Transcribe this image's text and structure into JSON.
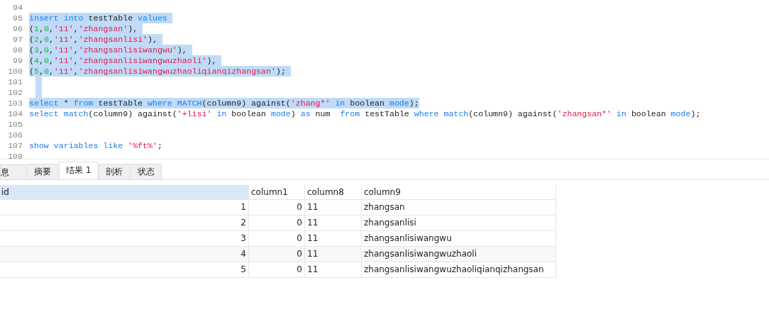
{
  "editor": {
    "lines": [
      {
        "number": "94",
        "selected": false
      },
      {
        "number": "95",
        "selected": true,
        "tokens": [
          {
            "text": "insert into ",
            "kind": "keyword"
          },
          {
            "text": "testTable ",
            "kind": "plain"
          },
          {
            "text": "values ",
            "kind": "keyword"
          }
        ]
      },
      {
        "number": "96",
        "selected": true,
        "tokens": [
          {
            "text": "(",
            "kind": "plain"
          },
          {
            "text": "1",
            "kind": "number"
          },
          {
            "text": ",",
            "kind": "plain"
          },
          {
            "text": "0",
            "kind": "number"
          },
          {
            "text": ",",
            "kind": "plain"
          },
          {
            "text": "'11'",
            "kind": "string"
          },
          {
            "text": ",",
            "kind": "plain"
          },
          {
            "text": "'zhangsan'",
            "kind": "string"
          },
          {
            "text": "), ",
            "kind": "plain"
          }
        ]
      },
      {
        "number": "97",
        "selected": true,
        "tokens": [
          {
            "text": "(",
            "kind": "plain"
          },
          {
            "text": "2",
            "kind": "number"
          },
          {
            "text": ",",
            "kind": "plain"
          },
          {
            "text": "0",
            "kind": "number"
          },
          {
            "text": ",",
            "kind": "plain"
          },
          {
            "text": "'11'",
            "kind": "string"
          },
          {
            "text": ",",
            "kind": "plain"
          },
          {
            "text": "'zhangsanlisi'",
            "kind": "string"
          },
          {
            "text": "), ",
            "kind": "plain"
          }
        ]
      },
      {
        "number": "98",
        "selected": true,
        "tokens": [
          {
            "text": "(",
            "kind": "plain"
          },
          {
            "text": "3",
            "kind": "number"
          },
          {
            "text": ",",
            "kind": "plain"
          },
          {
            "text": "0",
            "kind": "number"
          },
          {
            "text": ",",
            "kind": "plain"
          },
          {
            "text": "'11'",
            "kind": "string"
          },
          {
            "text": ",",
            "kind": "plain"
          },
          {
            "text": "'zhangsanlisiwangwu'",
            "kind": "string"
          },
          {
            "text": "), ",
            "kind": "plain"
          }
        ]
      },
      {
        "number": "99",
        "selected": true,
        "tokens": [
          {
            "text": "(",
            "kind": "plain"
          },
          {
            "text": "4",
            "kind": "number"
          },
          {
            "text": ",",
            "kind": "plain"
          },
          {
            "text": "0",
            "kind": "number"
          },
          {
            "text": ",",
            "kind": "plain"
          },
          {
            "text": "'11'",
            "kind": "string"
          },
          {
            "text": ",",
            "kind": "plain"
          },
          {
            "text": "'zhangsanlisiwangwuzhaoli'",
            "kind": "string"
          },
          {
            "text": "), ",
            "kind": "plain"
          }
        ]
      },
      {
        "number": "100",
        "selected": true,
        "tokens": [
          {
            "text": "(",
            "kind": "plain"
          },
          {
            "text": "5",
            "kind": "number"
          },
          {
            "text": ",",
            "kind": "plain"
          },
          {
            "text": "0",
            "kind": "number"
          },
          {
            "text": ",",
            "kind": "plain"
          },
          {
            "text": "'11'",
            "kind": "string"
          },
          {
            "text": ",",
            "kind": "plain"
          },
          {
            "text": "'zhangsanlisiwangwuzhaoliqianqizhangsan'",
            "kind": "string"
          },
          {
            "text": "); ",
            "kind": "plain"
          }
        ]
      },
      {
        "number": "101",
        "selected": true
      },
      {
        "number": "102",
        "selected": true
      },
      {
        "number": "103",
        "selected": true,
        "tokens": [
          {
            "text": "select ",
            "kind": "keyword"
          },
          {
            "text": "* ",
            "kind": "plain"
          },
          {
            "text": "from ",
            "kind": "keyword"
          },
          {
            "text": "testTable ",
            "kind": "plain"
          },
          {
            "text": "where MATCH",
            "kind": "keyword"
          },
          {
            "text": "(column9) against(",
            "kind": "plain"
          },
          {
            "text": "'zhang*'",
            "kind": "string"
          },
          {
            "text": " in ",
            "kind": "keyword"
          },
          {
            "text": "boolean ",
            "kind": "plain"
          },
          {
            "text": "mode",
            "kind": "keyword"
          },
          {
            "text": ");",
            "kind": "plain"
          }
        ]
      },
      {
        "number": "104",
        "selected": false,
        "tokens": [
          {
            "text": "select match",
            "kind": "keyword"
          },
          {
            "text": "(column9) against(",
            "kind": "plain"
          },
          {
            "text": "'+lisi'",
            "kind": "string"
          },
          {
            "text": " in ",
            "kind": "keyword"
          },
          {
            "text": "boolean ",
            "kind": "plain"
          },
          {
            "text": "mode",
            "kind": "keyword"
          },
          {
            "text": ") ",
            "kind": "plain"
          },
          {
            "text": "as ",
            "kind": "keyword"
          },
          {
            "text": "num  ",
            "kind": "plain"
          },
          {
            "text": "from ",
            "kind": "keyword"
          },
          {
            "text": "testTable ",
            "kind": "plain"
          },
          {
            "text": "where match",
            "kind": "keyword"
          },
          {
            "text": "(column9) against(",
            "kind": "plain"
          },
          {
            "text": "'zhangsan*'",
            "kind": "string"
          },
          {
            "text": " in ",
            "kind": "keyword"
          },
          {
            "text": "boolean ",
            "kind": "plain"
          },
          {
            "text": "mode",
            "kind": "keyword"
          },
          {
            "text": ");",
            "kind": "plain"
          }
        ]
      },
      {
        "number": "105",
        "selected": false
      },
      {
        "number": "106",
        "selected": false
      },
      {
        "number": "107",
        "selected": false,
        "tokens": [
          {
            "text": "show variables like ",
            "kind": "keyword"
          },
          {
            "text": "'%ft%'",
            "kind": "string"
          },
          {
            "text": ";",
            "kind": "plain"
          }
        ]
      },
      {
        "number": "108",
        "selected": false
      }
    ]
  },
  "tabs": [
    {
      "label": "息",
      "selected": false
    },
    {
      "label": "摘要",
      "selected": false
    },
    {
      "label": "结果 1",
      "selected": true
    },
    {
      "label": "剖析",
      "selected": false
    },
    {
      "label": "状态",
      "selected": false
    }
  ],
  "table": {
    "columns": [
      "id",
      "column1",
      "column8",
      "column9"
    ],
    "rows": [
      [
        "1",
        "0",
        "11",
        "zhangsan"
      ],
      [
        "2",
        "0",
        "11",
        "zhangsanlisi"
      ],
      [
        "3",
        "0",
        "11",
        "zhangsanlisiwangwu"
      ],
      [
        "4",
        "0",
        "11",
        "zhangsanlisiwangwuzhaoli"
      ],
      [
        "5",
        "0",
        "11",
        "zhangsanlisiwangwuzhaoliqianqizhangsan"
      ]
    ]
  }
}
